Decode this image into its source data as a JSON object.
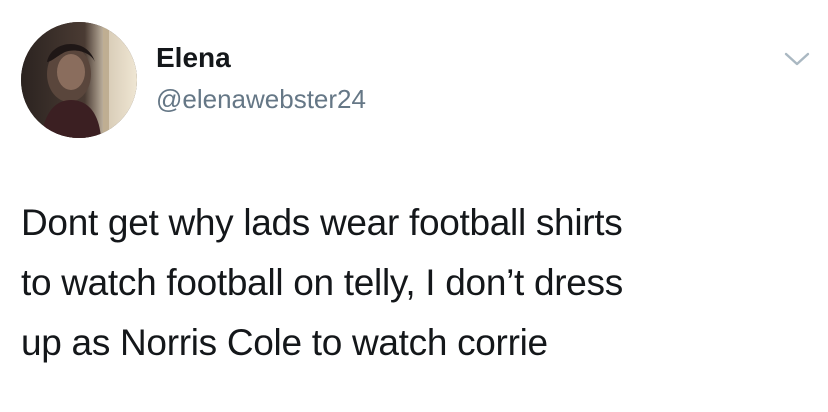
{
  "author": {
    "display_name": "Elena",
    "handle": "@elenawebster24",
    "avatar_icon": "profile-photo"
  },
  "menu": {
    "icon": "chevron-down-icon",
    "color": "#aab8c2"
  },
  "tweet": {
    "lines": [
      "Dont get why lads wear football shirts",
      "to watch football on telly, I don’t dress",
      "up as Norris Cole to watch corrie"
    ]
  },
  "colors": {
    "text": "#14171a",
    "secondary": "#657786",
    "background": "#ffffff"
  }
}
